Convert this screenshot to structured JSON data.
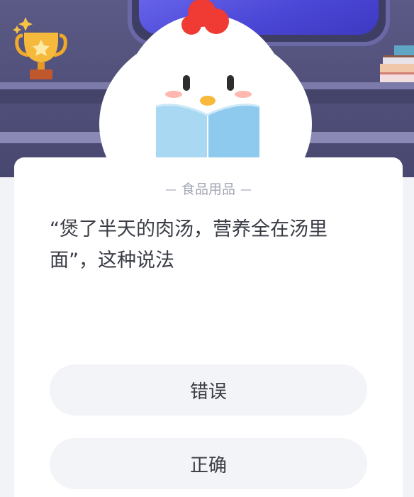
{
  "quiz": {
    "category": "食品用品",
    "question": "“煲了半天的肉汤，营养全在汤里面”，这种说法",
    "options": [
      {
        "label": "错误"
      },
      {
        "label": "正确"
      }
    ]
  },
  "colors": {
    "scene_background": "#5b5a86",
    "card_background": "#ffffff",
    "option_background": "#f3f4f7",
    "text": "#3a3c45",
    "category_text": "#a2a6b3"
  },
  "icons": [
    "trophy-icon",
    "books-icon",
    "chick-mascot-icon"
  ]
}
